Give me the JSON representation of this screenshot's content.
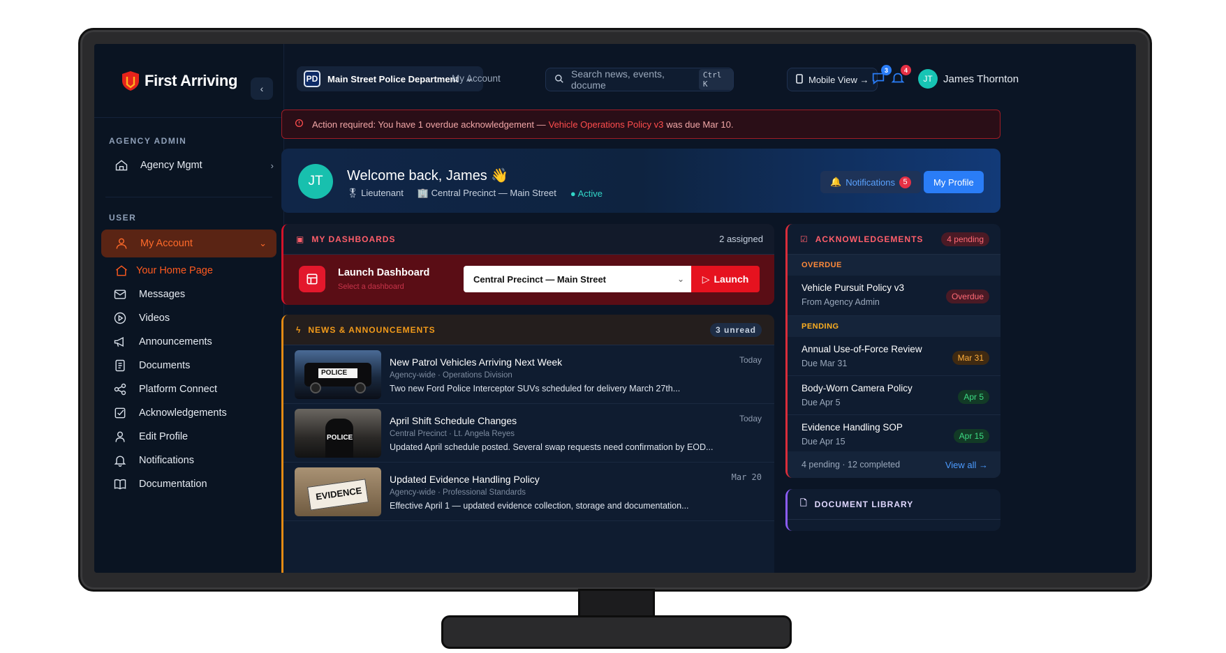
{
  "brand": {
    "name": "First Arriving"
  },
  "sidebar": {
    "admin_label": "AGENCY ADMIN",
    "agency_item": "Agency Mgmt",
    "user_label": "USER",
    "my_account": "My Account",
    "items": [
      {
        "label": "Your Home Page",
        "icon": "home-icon"
      },
      {
        "label": "Messages",
        "icon": "mail-icon"
      },
      {
        "label": "Videos",
        "icon": "play-icon"
      },
      {
        "label": "Announcements",
        "icon": "megaphone-icon"
      },
      {
        "label": "Documents",
        "icon": "document-icon"
      },
      {
        "label": "Platform Connect",
        "icon": "share-icon"
      },
      {
        "label": "Acknowledgements",
        "icon": "check-square-icon"
      },
      {
        "label": "Edit Profile",
        "icon": "user-icon"
      },
      {
        "label": "Notifications",
        "icon": "bell-icon"
      },
      {
        "label": "Documentation",
        "icon": "book-icon"
      }
    ]
  },
  "topbar": {
    "dept_badge": "PD",
    "dept_name": "Main Street Police Department",
    "my_account_link": "My Account",
    "search_placeholder": "Search news, events, docume",
    "search_shortcut": "Ctrl K",
    "mobile_view": "Mobile View →",
    "messages_count": "3",
    "notifications_count": "4",
    "avatar_initials": "JT",
    "user_name": "James Thornton"
  },
  "alert": {
    "prefix": "Action required: You have 1 overdue acknowledgement —",
    "highlight": "Vehicle Operations Policy v3",
    "suffix": "was due Mar 10."
  },
  "welcome": {
    "initials": "JT",
    "greeting": "Welcome back, James 👋",
    "rank": "Lieutenant",
    "precinct": "Central Precinct — Main Street",
    "status": "Active",
    "notifications_label": "Notifications",
    "notifications_count": "5",
    "profile_label": "My Profile"
  },
  "dashboards": {
    "title": "MY DASHBOARDS",
    "assigned": "2 assigned",
    "launch_title": "Launch Dashboard",
    "launch_sub": "Select a dashboard",
    "selected": "Central Precinct — Main Street",
    "launch_button": "Launch"
  },
  "news": {
    "title": "NEWS & ANNOUNCEMENTS",
    "unread": "3 unread",
    "items": [
      {
        "title": "New Patrol Vehicles Arriving Next Week",
        "meta": "Agency-wide · Operations Division",
        "text": "Two new Ford Police Interceptor SUVs scheduled for delivery March 27th...",
        "date": "Today",
        "thumb_text": "POLICE"
      },
      {
        "title": "April Shift Schedule Changes",
        "meta": "Central Precinct · Lt. Angela Reyes",
        "text": "Updated April schedule posted. Several swap requests need confirmation by EOD...",
        "date": "Today",
        "thumb_text": "POLICE"
      },
      {
        "title": "Updated Evidence Handling Policy",
        "meta": "Agency-wide · Professional Standards",
        "text": "Effective April 1 — updated evidence collection, storage and documentation...",
        "date": "Mar 20",
        "thumb_text": "EVIDENCE"
      }
    ]
  },
  "acks": {
    "title": "ACKNOWLEDGEMENTS",
    "pending_pill": "4 pending",
    "overdue_label": "OVERDUE",
    "pending_label": "PENDING",
    "overdue": [
      {
        "title": "Vehicle Pursuit Policy v3",
        "sub": "From Agency Admin",
        "pill": "Overdue"
      }
    ],
    "pending": [
      {
        "title": "Annual Use-of-Force Review",
        "sub": "Due Mar 31",
        "pill": "Mar 31"
      },
      {
        "title": "Body-Worn Camera Policy",
        "sub": "Due Apr 5",
        "pill": "Apr 5"
      },
      {
        "title": "Evidence Handling SOP",
        "sub": "Due Apr 15",
        "pill": "Apr 15"
      }
    ],
    "footer": "4 pending · 12 completed",
    "view_all": "View all →"
  },
  "doclib": {
    "title": "DOCUMENT LIBRARY"
  },
  "colors": {
    "accent": "#ff5a1f",
    "primary": "#2a7df7",
    "danger": "#e6121f"
  }
}
